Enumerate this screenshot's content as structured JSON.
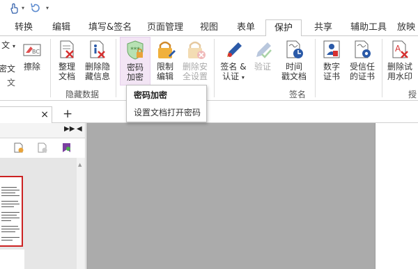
{
  "quick_access": {
    "icons": [
      "hand-tool-icon",
      "undo-icon",
      "customize-icon"
    ]
  },
  "tabs": [
    {
      "label": "转换"
    },
    {
      "label": "编辑"
    },
    {
      "label": "填写&签名"
    },
    {
      "label": "页面管理"
    },
    {
      "label": "视图"
    },
    {
      "label": "表单"
    },
    {
      "label": "保护",
      "active": true
    },
    {
      "label": "共享"
    },
    {
      "label": "辅助工具"
    },
    {
      "label": "放映"
    }
  ],
  "ribbon": {
    "left_cut": {
      "line1": "文",
      "line2": "密文",
      "line3": "文"
    },
    "erase": {
      "label": "擦除"
    },
    "hidden_data": {
      "organize": {
        "line1": "整理",
        "line2": "文档"
      },
      "remove_hidden": {
        "line1": "删除隐",
        "line2": "藏信息"
      },
      "group_label": "隐藏数据"
    },
    "security": {
      "password": {
        "line1": "密码",
        "line2": "加密"
      },
      "restrict": {
        "line1": "限制",
        "line2": "编辑"
      },
      "remove_security": {
        "line1": "删除安",
        "line2": "全设置"
      }
    },
    "sign": {
      "sign_cert": {
        "line1": "签名 &",
        "line2": "认证"
      },
      "verify": {
        "label": "验证"
      },
      "timestamp": {
        "line1": "时间",
        "line2": "戳文档"
      },
      "group_label": "签名"
    },
    "certs": {
      "digital": {
        "line1": "数字",
        "line2": "证书"
      },
      "trusted": {
        "line1": "受信任",
        "line2": "的证书"
      }
    },
    "watermark": {
      "remove_test": {
        "line1": "删除试",
        "line2": "用水印"
      },
      "group_label_cut": "授"
    }
  },
  "tooltip": {
    "title": "密码加密",
    "description": "设置文档打开密码"
  },
  "doc_tabs": {
    "close_glyph": "×",
    "new_glyph": "+"
  },
  "panel": {
    "controls": [
      "▶▶",
      "◀"
    ]
  },
  "colors": {
    "accent_blue": "#2b5aa8",
    "highlight_purple": "#f3e5f5",
    "thumb_border": "#cc2222",
    "workspace_gray": "#ababab"
  }
}
